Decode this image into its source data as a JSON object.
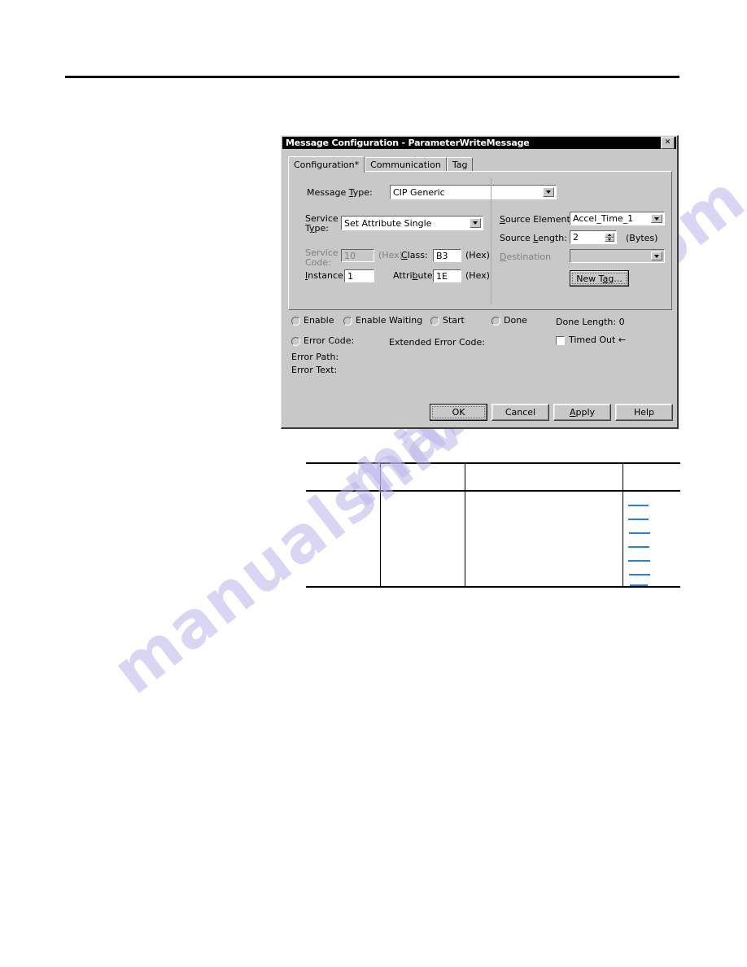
{
  "page": {
    "rule": "horizontal-rule",
    "watermark_lines": [
      "manualshive",
      "manuals.com"
    ]
  },
  "dialog": {
    "title": "Message Configuration - ParameterWriteMessage",
    "close_label": "✕",
    "tabs": [
      {
        "label": "Configuration*",
        "active": true
      },
      {
        "label": "Communication",
        "active": false
      },
      {
        "label": "Tag",
        "active": false
      }
    ],
    "fields": {
      "message_type_label": "Message Type:",
      "message_type_value": "CIP Generic",
      "service_type_label_1": "Service",
      "service_type_label_2": "Type:",
      "service_type_value": "Set Attribute Single",
      "service_code_label_1": "Service",
      "service_code_label_2": "Code:",
      "service_code_value": "10",
      "service_code_hex": "(Hex)",
      "class_label": "Class:",
      "class_value": "B3",
      "class_hex": "(Hex)",
      "instance_label": "Instance:",
      "instance_value": "1",
      "attribute_label": "Attribute:",
      "attribute_value": "1E",
      "attribute_hex": "(Hex)",
      "source_element_label": "Source Element:",
      "source_element_value": "Accel_Time_1",
      "source_length_label": "Source Length:",
      "source_length_value": "2",
      "source_length_units": "(Bytes)",
      "destination_label": "Destination",
      "destination_value": "",
      "new_tag_label": "New Tag..."
    },
    "status": {
      "enable": "Enable",
      "enable_waiting": "Enable Waiting",
      "start": "Start",
      "done": "Done",
      "done_length": "Done Length:  0",
      "error_code": "Error Code:",
      "extended_error_code": "Extended Error Code:",
      "timed_out": "Timed Out ←",
      "error_path": "Error Path:",
      "error_text": "Error Text:"
    },
    "buttons": {
      "ok": "OK",
      "cancel": "Cancel",
      "apply": "Apply",
      "help": "Help"
    }
  },
  "table": {
    "columns": [
      "",
      "",
      "",
      ""
    ],
    "header_row": [
      "",
      "",
      "",
      ""
    ],
    "body_row": [
      "",
      "",
      "",
      ""
    ],
    "link_marks": 7
  }
}
